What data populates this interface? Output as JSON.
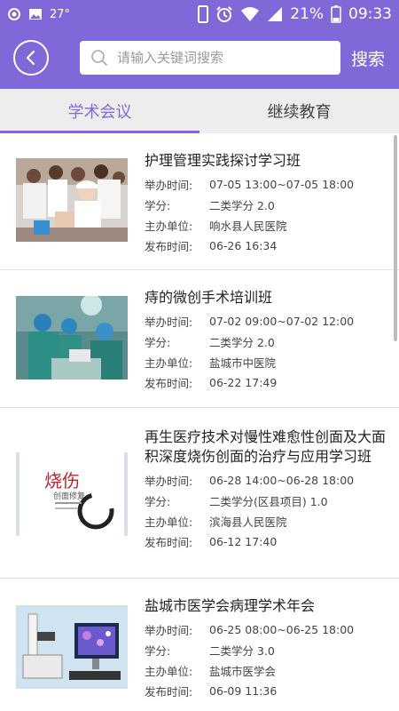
{
  "status_bar": {
    "temperature": "27°",
    "battery": "21%",
    "time": "09:33"
  },
  "header": {
    "search_placeholder": "请输入关键词搜索",
    "search_label": "搜索"
  },
  "tabs": [
    {
      "label": "学术会议",
      "active": true
    },
    {
      "label": "继续教育",
      "active": false
    }
  ],
  "field_labels": {
    "time": "举办时间:",
    "credit": "学分:",
    "organizer": "主办单位:",
    "published": "发布时间:"
  },
  "items": [
    {
      "title": "护理管理实践探讨学习班",
      "time": "07-05 13:00~07-05 18:00",
      "credit": "二类学分 2.0",
      "organizer": "响水县人民医院",
      "published": "06-26 16:34"
    },
    {
      "title": "痔的微创手术培训班",
      "time": "07-02 09:00~07-02 12:00",
      "credit": "二类学分 2.0",
      "organizer": "盐城市中医院",
      "published": "06-22 17:49"
    },
    {
      "title": "再生医疗技术对慢性难愈性创面及大面积深度烧伤创面的治疗与应用学习班",
      "time": "06-28 14:00~06-28 18:00",
      "credit": "二类学分(区县项目) 1.0",
      "organizer": "滨海县人民医院",
      "published": "06-12 17:40",
      "thumb_text": "烧伤",
      "thumb_subtext": "创面修复"
    },
    {
      "title": "盐城市医学会病理学术年会",
      "time": "06-25 08:00~06-25 18:00",
      "credit": "二类学分 3.0",
      "organizer": "盐城市医学会",
      "published": "06-09 11:36"
    }
  ]
}
